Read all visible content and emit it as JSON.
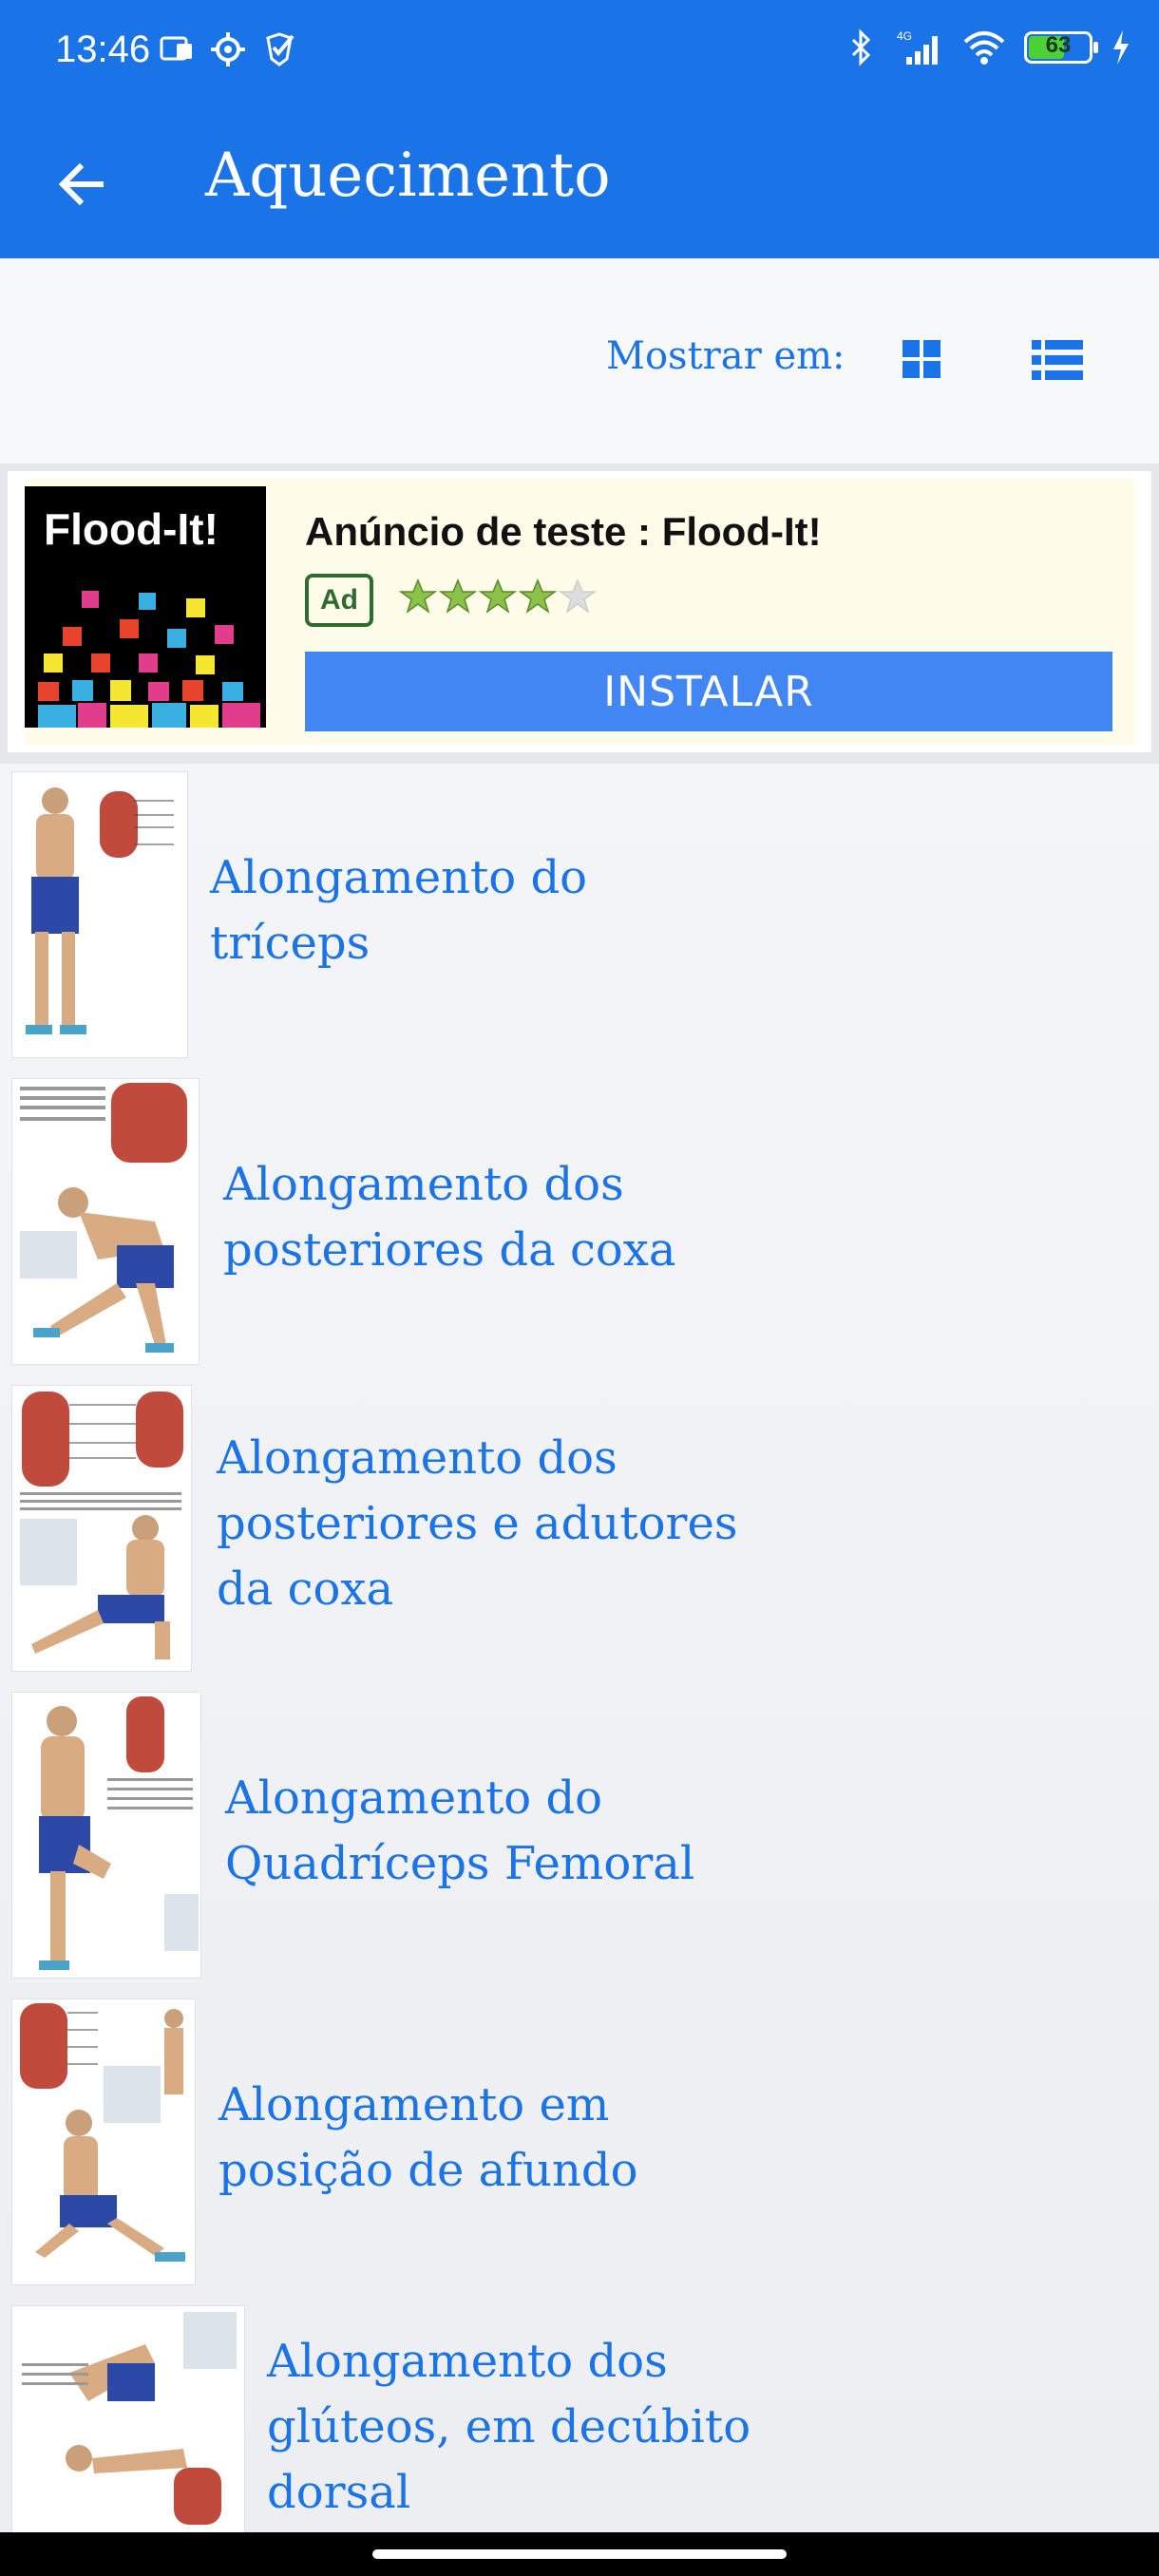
{
  "status_bar": {
    "time": "13:46",
    "battery": "63",
    "network": "4G"
  },
  "app_bar": {
    "title": "Aquecimento"
  },
  "view_toggle": {
    "label": "Mostrar em:"
  },
  "ad": {
    "logo_text": "Flood-It!",
    "headline": "Anúncio de teste : Flood-It!",
    "badge": "Ad",
    "rating": 4,
    "install_label": "INSTALAR"
  },
  "exercises": [
    {
      "title": "Alongamento do tríceps"
    },
    {
      "title": "Alongamento dos posteriores da coxa"
    },
    {
      "title": "Alongamento dos posteriores e adutores da coxa"
    },
    {
      "title": "Alongamento do Quadríceps Femoral"
    },
    {
      "title": "Alongamento em posição de afundo"
    },
    {
      "title": "Alongamento dos glúteos, em decúbito dorsal"
    }
  ],
  "colors": {
    "primary": "#1b73e8",
    "ad_button": "#4286f4",
    "ad_background": "#fffcea"
  },
  "icons": [
    "back-arrow-icon",
    "grid-view-icon",
    "list-view-icon",
    "bluetooth-icon",
    "signal-icon",
    "wifi-icon",
    "battery-icon",
    "star-icon"
  ]
}
